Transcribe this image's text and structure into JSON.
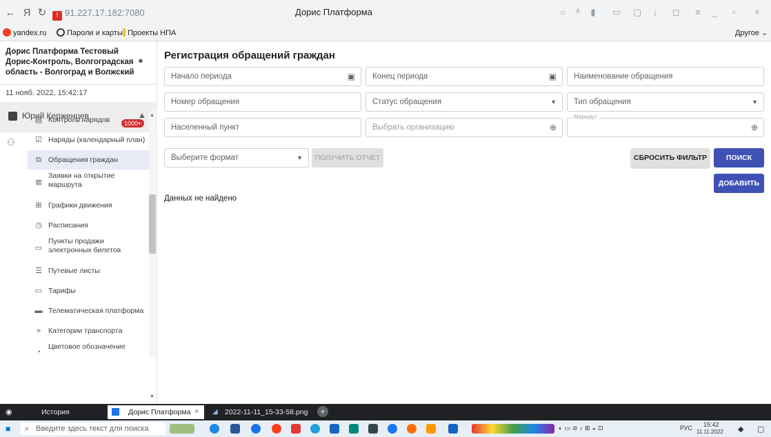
{
  "browser": {
    "url": "91.227.17.182:7080",
    "tab_title": "Дорис Платформа",
    "bookmarks": [
      "yandex.ru",
      "Пароли и карты",
      "Проекты НПА"
    ],
    "bookmarks_other": "Другое"
  },
  "sidebar": {
    "org_title": "Дорис Платформа Тестовый Дорис-Контроль, Волгоградская область - Волгоград и Волжский",
    "datetime": "11 нояб. 2022, 15:42:17",
    "user_name": "Юрий Керженцев",
    "notifications_badge": "1000+",
    "menu": [
      {
        "label": "Контроль нарядов",
        "icon": "clipboard-icon"
      },
      {
        "label": "Наряды (календарный план)",
        "icon": "calendar-check-icon"
      },
      {
        "label": "Обращения граждан",
        "icon": "chat-icon",
        "active": true
      },
      {
        "label": "Заявки на открытие маршрута",
        "icon": "route-request-icon"
      },
      {
        "label": "Графики движения",
        "icon": "grid-icon"
      },
      {
        "label": "Расписания",
        "icon": "clock-icon"
      },
      {
        "label": "Пункты продажи электронных билетов",
        "icon": "ticket-terminal-icon"
      },
      {
        "label": "Путевые листы",
        "icon": "list-icon"
      },
      {
        "label": "Тарифы",
        "icon": "tariff-icon"
      },
      {
        "label": "Телематическая платформа",
        "icon": "monitor-icon"
      },
      {
        "label": "Категории транспорта",
        "icon": "double-chevron-icon"
      },
      {
        "label": "Цветовое обозначение",
        "icon": "palette-icon"
      }
    ]
  },
  "main": {
    "title": "Регистрация обращений граждан",
    "filters": {
      "period_start": "Начало периода",
      "period_end": "Конец периода",
      "appeal_name": "Наименование обращения",
      "appeal_number": "Номер обращения",
      "appeal_status": "Статус обращения",
      "appeal_type": "Тип обращения",
      "settlement": "Населенный пункт",
      "organization": "Выбрать организацию",
      "route_caption": "Маршрут",
      "format": "Выберите формат"
    },
    "buttons": {
      "get_report": "ПОЛУЧИТЬ ОТЧЕТ",
      "reset_filter": "СБРОСИТЬ ФИЛЬТР",
      "search": "ПОИСК",
      "add": "ДОБАВИТЬ"
    },
    "empty_message": "Данных не найдено"
  },
  "bottom_panel": {
    "history": "История",
    "tab_active": "Дорис Платформа",
    "tab_file": "2022-11-11_15-33-58.png"
  },
  "taskbar": {
    "search_placeholder": "Введите здесь текст для поиска",
    "lang": "РУС",
    "time": "15:42",
    "date": "11.11.2022"
  },
  "colors": {
    "primary": "#3f51b5",
    "badge": "#d32f2f",
    "active_item": "#e8eaf6"
  }
}
